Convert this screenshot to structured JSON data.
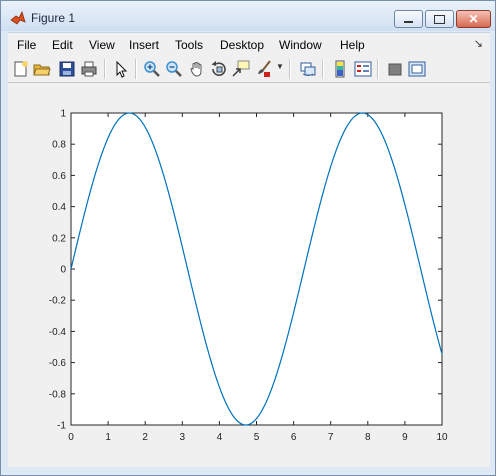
{
  "window": {
    "title": "Figure 1"
  },
  "menubar": {
    "items": [
      "File",
      "Edit",
      "View",
      "Insert",
      "Tools",
      "Desktop",
      "Window",
      "Help"
    ]
  },
  "toolbar": {
    "tools": [
      {
        "name": "new-figure-icon",
        "color": "#f6d56a"
      },
      {
        "name": "open-file-icon",
        "color": "#e7b43a"
      },
      {
        "name": "save-icon",
        "color": "#2c4f9a"
      },
      {
        "name": "print-icon",
        "color": "#8b8b8b"
      },
      {
        "name": "select-arrow-icon",
        "color": "#111111"
      },
      {
        "name": "zoom-in-icon",
        "color": "#3d8fd1"
      },
      {
        "name": "zoom-out-icon",
        "color": "#3d8fd1"
      },
      {
        "name": "pan-hand-icon",
        "color": "#7b6a55"
      },
      {
        "name": "rotate-3d-icon",
        "color": "#444444"
      },
      {
        "name": "data-cursor-icon",
        "color": "#3a3a3a"
      },
      {
        "name": "brush-icon",
        "color": "#d0201a"
      },
      {
        "name": "link-plot-icon",
        "color": "#2f5d9a"
      },
      {
        "name": "colorbar-icon",
        "color": "#3a62c7"
      },
      {
        "name": "legend-icon",
        "color": "#2f5d9a"
      },
      {
        "name": "hide-plot-tools-icon",
        "color": "#7f7f7f"
      },
      {
        "name": "show-plot-tools-icon",
        "color": "#2f5d9a"
      }
    ]
  },
  "chart_data": {
    "type": "line",
    "function": "y = sin(x)",
    "xlim": [
      0,
      10
    ],
    "ylim": [
      -1,
      1
    ],
    "x_ticks": [
      "0",
      "1",
      "2",
      "3",
      "4",
      "5",
      "6",
      "7",
      "8",
      "9",
      "10"
    ],
    "y_ticks": [
      "1",
      "0.8",
      "0.6",
      "0.4",
      "0.2",
      "0",
      "-0.2",
      "-0.4",
      "-0.6",
      "-0.8",
      "-1"
    ],
    "series": [
      {
        "color": "#0072bd",
        "x_range": [
          0,
          10
        ],
        "samples": 201
      }
    ]
  }
}
